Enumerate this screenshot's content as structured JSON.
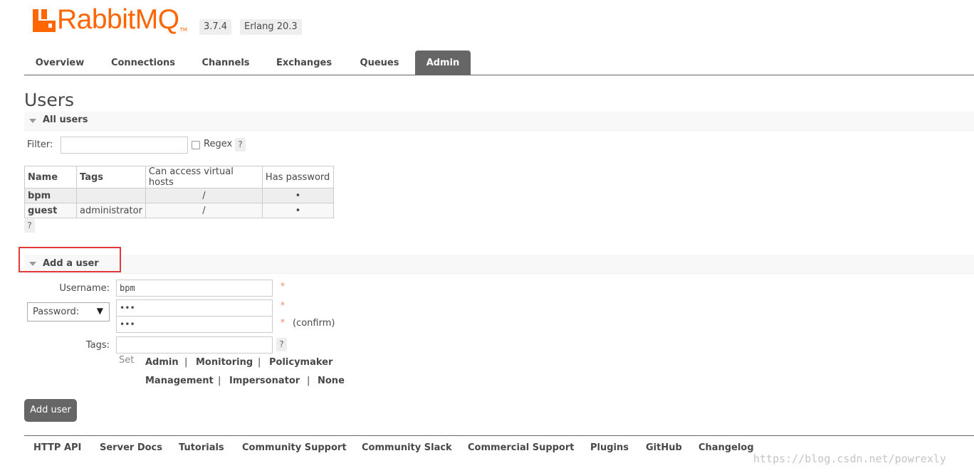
{
  "header": {
    "brand": "RabbitMQ",
    "trademark": "TM",
    "version": "3.7.4",
    "erlang": "Erlang 20.3",
    "brand_color": "#ff6600"
  },
  "nav": {
    "tabs": [
      {
        "label": "Overview"
      },
      {
        "label": "Connections"
      },
      {
        "label": "Channels"
      },
      {
        "label": "Exchanges"
      },
      {
        "label": "Queues"
      },
      {
        "label": "Admin"
      }
    ],
    "active": "Admin"
  },
  "page": {
    "title": "Users"
  },
  "all_users": {
    "heading": "All users",
    "filter_label": "Filter:",
    "filter_value": "",
    "regex_label": "Regex",
    "help": "?",
    "columns": [
      "Name",
      "Tags",
      "Can access virtual hosts",
      "Has password"
    ],
    "rows": [
      {
        "name": "bpm",
        "tags": "",
        "vhosts": "/",
        "has_password": "•"
      },
      {
        "name": "guest",
        "tags": "administrator",
        "vhosts": "/",
        "has_password": "•"
      }
    ],
    "table_help": "?"
  },
  "add_user": {
    "heading": "Add a user",
    "username_label": "Username:",
    "username_value": "bpm",
    "password_select": "Password:",
    "password_value": "•••",
    "confirm_value": "•••",
    "required": "*",
    "confirm_label": "(confirm)",
    "tags_label": "Tags:",
    "tags_value": "",
    "tags_help": "?",
    "set_label": "Set",
    "tag_options_row1": [
      "Admin",
      "Monitoring",
      "Policymaker"
    ],
    "tag_options_row2": [
      "Management",
      "Impersonator",
      "None"
    ],
    "separator": "|",
    "submit_label": "Add user"
  },
  "footer": {
    "links": [
      "HTTP API",
      "Server Docs",
      "Tutorials",
      "Community Support",
      "Community Slack",
      "Commercial Support",
      "Plugins",
      "GitHub",
      "Changelog"
    ]
  },
  "watermark": "https://blog.csdn.net/powrexly"
}
